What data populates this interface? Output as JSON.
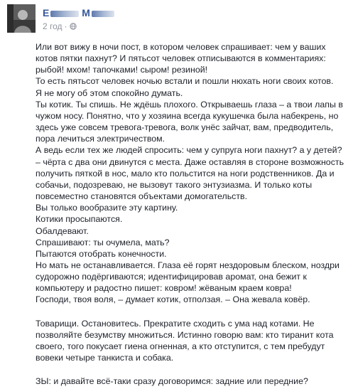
{
  "post": {
    "author": "Е",
    "author_rest": "М",
    "time": "2 год",
    "dot": "·",
    "paragraphs": [
      "Или вот вижу в ночи пост, в котором человек спрашивает: чем у ваших котов пятки пахнут? И пятьсот человек отписываются в комментариях: рыбой! мхом! тапочками! сыром! резиной!",
      "То есть пятьсот человек ночью встали и пошли нюхать ноги своих котов.",
      "Я не могу об этом спокойно думать.",
      "Ты котик. Ты спишь. Не ждёшь плохого. Открываешь глаза – а твои лапы в чужом носу. Понятно, что у хозяина всегда кукушечка была набекрень, но здесь уже совсем тревога-тревога, волк унёс зайчат, вам, предводитель, пора лечиться электричеством.",
      "А ведь если тех же людей спросить: чем у супруга ноги пахнут? а у детей? – чёрта с два они двинутся с места. Даже оставляя в стороне возможность получить пяткой в нос, мало кто польстится на ноги родственников. Да и собачьи, подозреваю, не вызовут такого энтузиазма. И только коты повсеместно становятся объектами домогательств.",
      "Вы только вообразите эту картину.",
      "Котики просыпаются.",
      "Обалдевают.",
      "Спрашивают: ты очумела, мать?",
      "Пытаются отобрать конечности.",
      "Но мать не останавливается. Глаза её горят нездоровым блеском, ноздри судорожно подёргиваются; идентифицировав аромат, она бежит к компьютеру и радостно пишет: ковром! жёваным краем ковра!",
      "Господи, твоя воля, – думает котик, отползая. – Она жевала ковёр.",
      "",
      "Товарищи. Остановитесь. Прекратите сходить с ума над котами. Не позволяйте безумству множиться. Истинно говорю вам: кто тиранит кота своего, того покусает гиена огненная, а кто отступится, с тем пребудут вовеки четыре танкиста и собака.",
      "",
      "ЗЫ: и давайте всё-таки сразу договоримся: задние или передние?"
    ]
  },
  "icons": {
    "avatar": "avatar-photo",
    "privacy": "globe-icon"
  },
  "colors": {
    "link": "#365899",
    "text": "#1d2129",
    "meta": "#90949c"
  }
}
